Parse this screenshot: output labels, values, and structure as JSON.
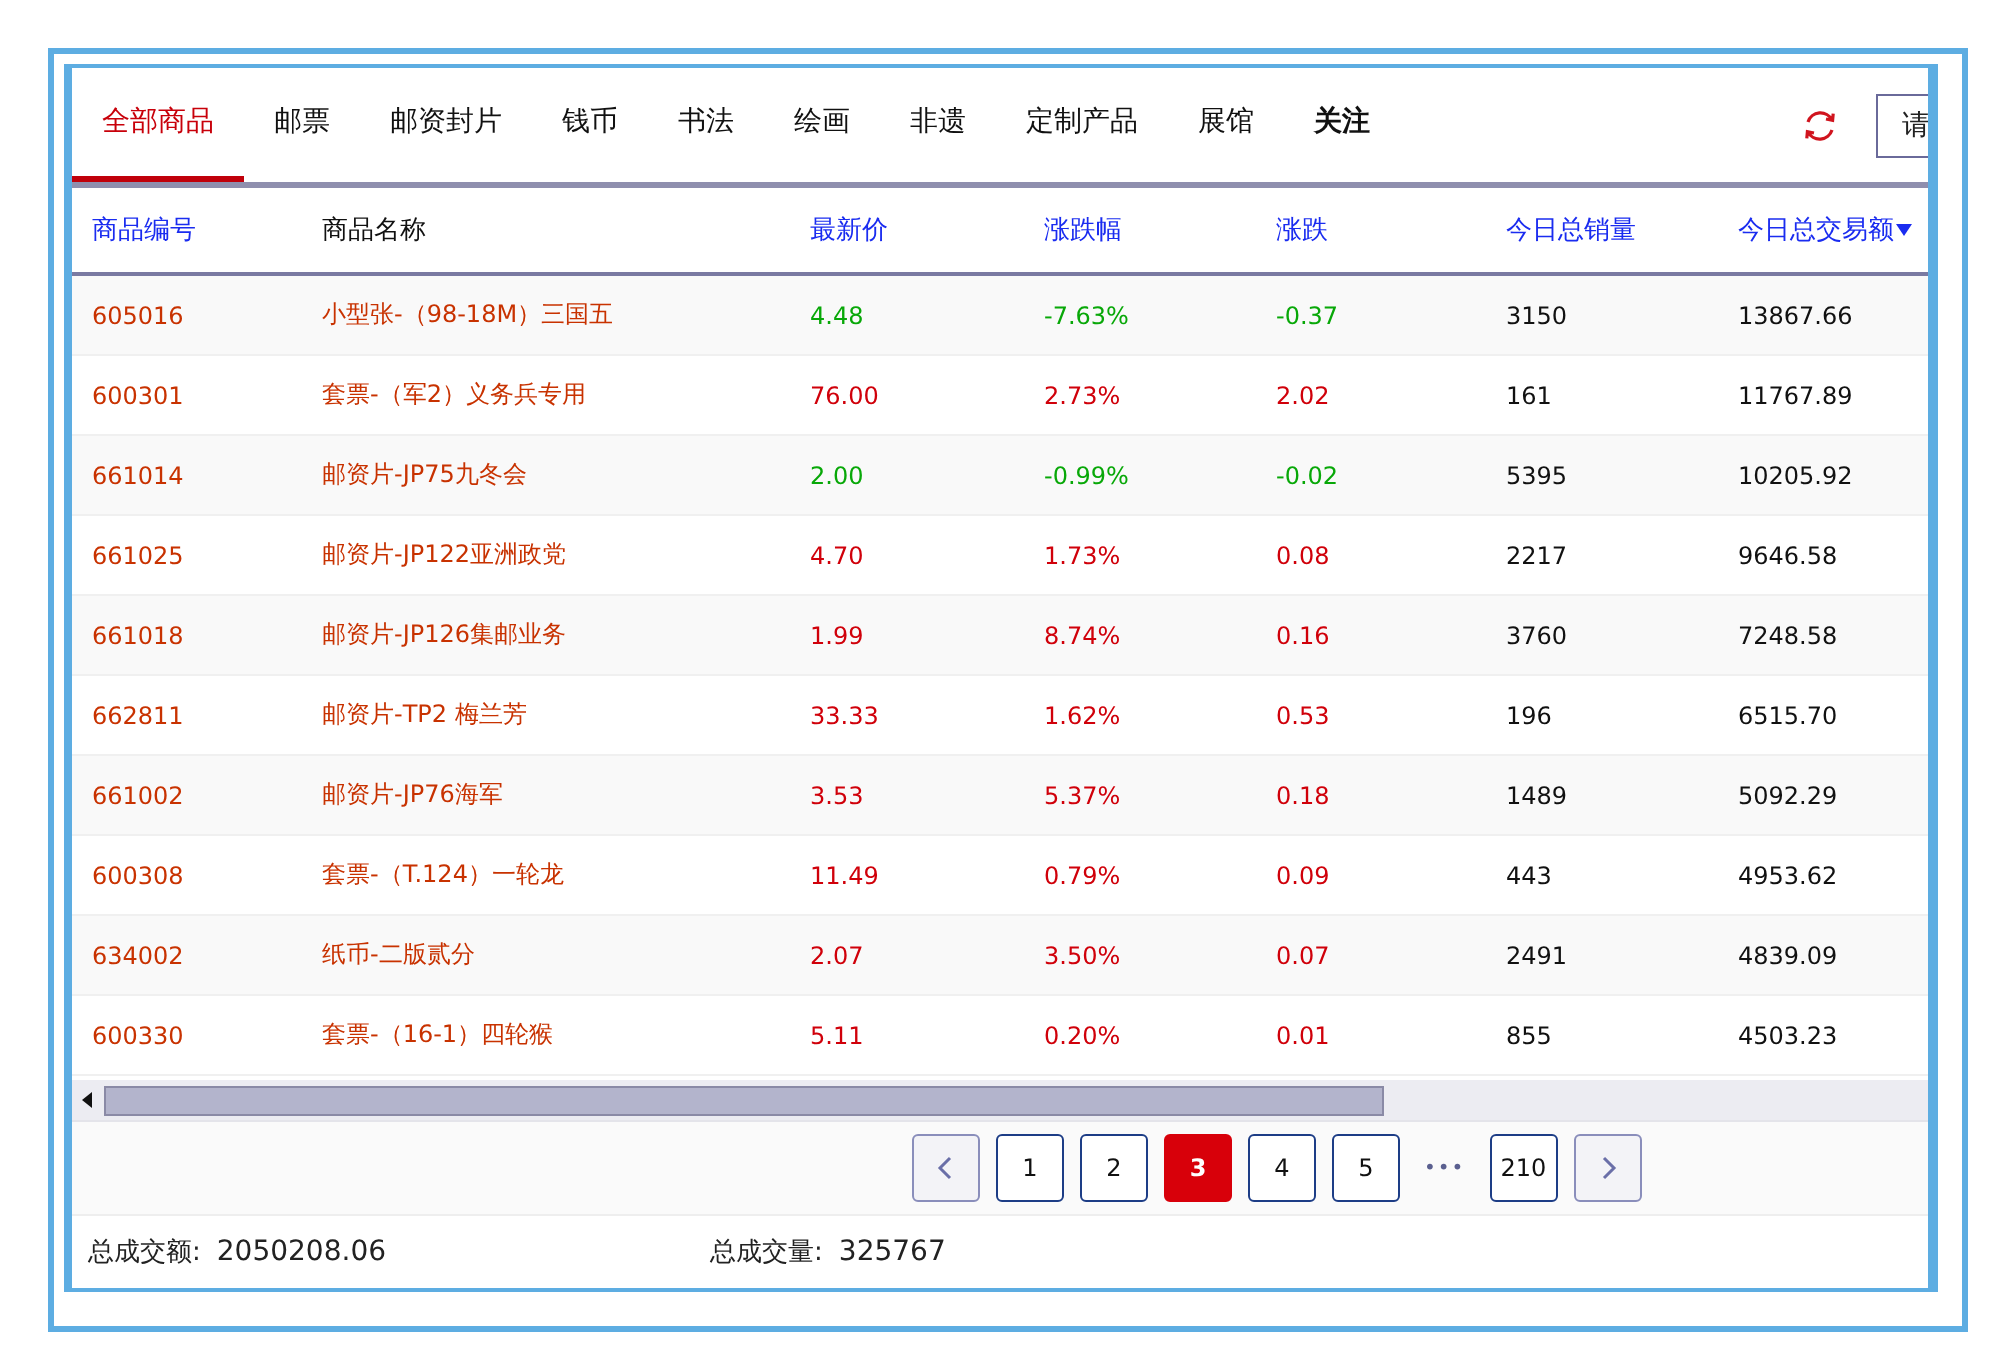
{
  "tabs": [
    {
      "label": "全部商品",
      "selected": true,
      "bold": false
    },
    {
      "label": "邮票",
      "selected": false,
      "bold": false
    },
    {
      "label": "邮资封片",
      "selected": false,
      "bold": false
    },
    {
      "label": "钱币",
      "selected": false,
      "bold": false
    },
    {
      "label": "书法",
      "selected": false,
      "bold": false
    },
    {
      "label": "绘画",
      "selected": false,
      "bold": false
    },
    {
      "label": "非遗",
      "selected": false,
      "bold": false
    },
    {
      "label": "定制产品",
      "selected": false,
      "bold": false
    },
    {
      "label": "展馆",
      "selected": false,
      "bold": false
    },
    {
      "label": "关注",
      "selected": false,
      "bold": true
    }
  ],
  "search": {
    "placeholder": "请"
  },
  "table": {
    "columns": [
      {
        "label": "商品编号",
        "sortable": true,
        "sorted": false
      },
      {
        "label": "商品名称",
        "sortable": false,
        "sorted": false
      },
      {
        "label": "最新价",
        "sortable": true,
        "sorted": false
      },
      {
        "label": "涨跌幅",
        "sortable": true,
        "sorted": false
      },
      {
        "label": "涨跌",
        "sortable": true,
        "sorted": false
      },
      {
        "label": "今日总销量",
        "sortable": true,
        "sorted": false
      },
      {
        "label": "今日总交易额",
        "sortable": true,
        "sorted": true
      }
    ],
    "rows": [
      {
        "code": "605016",
        "name": "小型张-（98-18M）三国五",
        "price": "4.48",
        "pct": "-7.63%",
        "change": "-0.37",
        "volume": "3150",
        "amount": "13867.66",
        "rising": false
      },
      {
        "code": "600301",
        "name": "套票-（军2）义务兵专用",
        "price": "76.00",
        "pct": "2.73%",
        "change": "2.02",
        "volume": "161",
        "amount": "11767.89",
        "rising": true
      },
      {
        "code": "661014",
        "name": "邮资片-JP75九冬会",
        "price": "2.00",
        "pct": "-0.99%",
        "change": "-0.02",
        "volume": "5395",
        "amount": "10205.92",
        "rising": false
      },
      {
        "code": "661025",
        "name": "邮资片-JP122亚洲政党",
        "price": "4.70",
        "pct": "1.73%",
        "change": "0.08",
        "volume": "2217",
        "amount": "9646.58",
        "rising": true
      },
      {
        "code": "661018",
        "name": "邮资片-JP126集邮业务",
        "price": "1.99",
        "pct": "8.74%",
        "change": "0.16",
        "volume": "3760",
        "amount": "7248.58",
        "rising": true
      },
      {
        "code": "662811",
        "name": "邮资片-TP2 梅兰芳",
        "price": "33.33",
        "pct": "1.62%",
        "change": "0.53",
        "volume": "196",
        "amount": "6515.70",
        "rising": true
      },
      {
        "code": "661002",
        "name": "邮资片-JP76海军",
        "price": "3.53",
        "pct": "5.37%",
        "change": "0.18",
        "volume": "1489",
        "amount": "5092.29",
        "rising": true
      },
      {
        "code": "600308",
        "name": "套票-（T.124）一轮龙",
        "price": "11.49",
        "pct": "0.79%",
        "change": "0.09",
        "volume": "443",
        "amount": "4953.62",
        "rising": true
      },
      {
        "code": "634002",
        "name": "纸币-二版贰分",
        "price": "2.07",
        "pct": "3.50%",
        "change": "0.07",
        "volume": "2491",
        "amount": "4839.09",
        "rising": true
      },
      {
        "code": "600330",
        "name": "套票-（16-1）四轮猴",
        "price": "5.11",
        "pct": "0.20%",
        "change": "0.01",
        "volume": "855",
        "amount": "4503.23",
        "rising": true
      }
    ]
  },
  "pagination": [
    {
      "kind": "page",
      "label": "1",
      "selected": false
    },
    {
      "kind": "page",
      "label": "2",
      "selected": false
    },
    {
      "kind": "page",
      "label": "3",
      "selected": true
    },
    {
      "kind": "page",
      "label": "4",
      "selected": false
    },
    {
      "kind": "page",
      "label": "5",
      "selected": false
    },
    {
      "kind": "ellipsis",
      "label": "•••",
      "selected": false
    },
    {
      "kind": "page",
      "label": "210",
      "selected": false
    }
  ],
  "footer": {
    "amount_label": "总成交额:",
    "amount": "2050208.06",
    "volume_label": "总成交量:",
    "volume": "325767"
  }
}
